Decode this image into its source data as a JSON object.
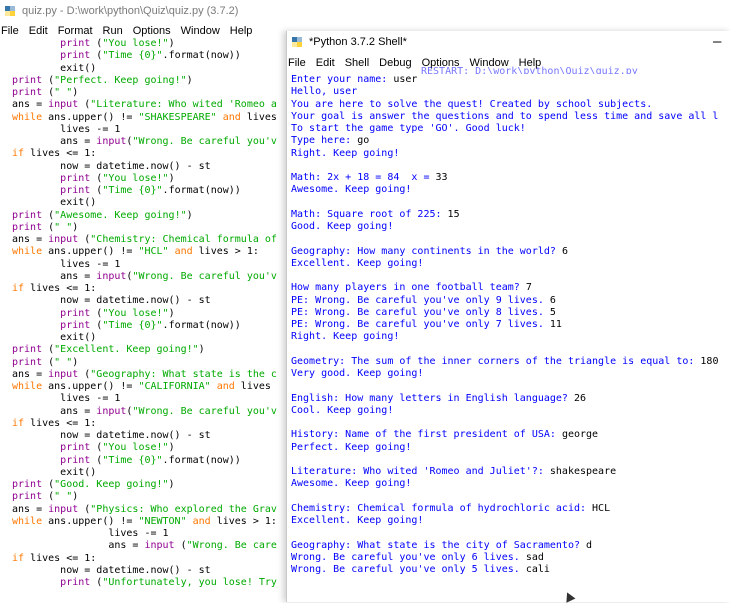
{
  "editor": {
    "title": "quiz.py - D:\\work\\python\\Quiz\\quiz.py (3.7.2)",
    "menu": [
      "File",
      "Edit",
      "Format",
      "Run",
      "Options",
      "Window",
      "Help"
    ],
    "lines": [
      {
        "indent": "        ",
        "parts": [
          [
            "bi",
            "print"
          ],
          [
            "tx",
            " ("
          ],
          [
            "st",
            "\"You lose!\""
          ],
          [
            "tx",
            ")"
          ]
        ]
      },
      {
        "indent": "        ",
        "parts": [
          [
            "bi",
            "print"
          ],
          [
            "tx",
            " ("
          ],
          [
            "st",
            "\"Time {0}\""
          ],
          [
            "tx",
            ".format(now))"
          ]
        ]
      },
      {
        "indent": "        ",
        "parts": [
          [
            "tx",
            "exit()"
          ]
        ]
      },
      {
        "indent": "",
        "parts": [
          [
            "bi",
            "print"
          ],
          [
            "tx",
            " ("
          ],
          [
            "st",
            "\"Perfect. Keep going!\""
          ],
          [
            "tx",
            ")"
          ]
        ]
      },
      {
        "indent": "",
        "parts": [
          [
            "bi",
            "print"
          ],
          [
            "tx",
            " ("
          ],
          [
            "st",
            "\" \""
          ],
          [
            "tx",
            ")"
          ]
        ]
      },
      {
        "indent": "",
        "parts": [
          [
            "tx",
            "ans = "
          ],
          [
            "bi",
            "input"
          ],
          [
            "tx",
            " ("
          ],
          [
            "st",
            "\"Literature: Who wited 'Romeo a"
          ]
        ]
      },
      {
        "indent": "",
        "parts": [
          [
            "kw",
            "while"
          ],
          [
            "tx",
            " ans.upper() != "
          ],
          [
            "st",
            "\"SHAKESPEARE\""
          ],
          [
            "tx",
            " "
          ],
          [
            "kw",
            "and"
          ],
          [
            "tx",
            " lives"
          ]
        ]
      },
      {
        "indent": "        ",
        "parts": [
          [
            "tx",
            "lives -= 1"
          ]
        ]
      },
      {
        "indent": "        ",
        "parts": [
          [
            "tx",
            "ans = "
          ],
          [
            "bi",
            "input"
          ],
          [
            "tx",
            "("
          ],
          [
            "st",
            "\"Wrong. Be careful you'v"
          ]
        ]
      },
      {
        "indent": "",
        "parts": [
          [
            "kw",
            "if"
          ],
          [
            "tx",
            " lives <= 1:"
          ]
        ]
      },
      {
        "indent": "        ",
        "parts": [
          [
            "tx",
            "now = datetime.now() - st"
          ]
        ]
      },
      {
        "indent": "        ",
        "parts": [
          [
            "bi",
            "print"
          ],
          [
            "tx",
            " ("
          ],
          [
            "st",
            "\"You lose!\""
          ],
          [
            "tx",
            ")"
          ]
        ]
      },
      {
        "indent": "        ",
        "parts": [
          [
            "bi",
            "print"
          ],
          [
            "tx",
            " ("
          ],
          [
            "st",
            "\"Time {0}\""
          ],
          [
            "tx",
            ".format(now))"
          ]
        ]
      },
      {
        "indent": "        ",
        "parts": [
          [
            "tx",
            "exit()"
          ]
        ]
      },
      {
        "indent": "",
        "parts": [
          [
            "bi",
            "print"
          ],
          [
            "tx",
            " ("
          ],
          [
            "st",
            "\"Awesome. Keep going!\""
          ],
          [
            "tx",
            ")"
          ]
        ]
      },
      {
        "indent": "",
        "parts": [
          [
            "bi",
            "print"
          ],
          [
            "tx",
            " ("
          ],
          [
            "st",
            "\" \""
          ],
          [
            "tx",
            ")"
          ]
        ]
      },
      {
        "indent": "",
        "parts": [
          [
            "tx",
            "ans = "
          ],
          [
            "bi",
            "input"
          ],
          [
            "tx",
            " ("
          ],
          [
            "st",
            "\"Chemistry: Chemical formula of"
          ]
        ]
      },
      {
        "indent": "",
        "parts": [
          [
            "kw",
            "while"
          ],
          [
            "tx",
            " ans.upper() != "
          ],
          [
            "st",
            "\"HCL\""
          ],
          [
            "tx",
            " "
          ],
          [
            "kw",
            "and"
          ],
          [
            "tx",
            " lives > 1:"
          ]
        ]
      },
      {
        "indent": "        ",
        "parts": [
          [
            "tx",
            "lives -= 1"
          ]
        ]
      },
      {
        "indent": "        ",
        "parts": [
          [
            "tx",
            "ans = "
          ],
          [
            "bi",
            "input"
          ],
          [
            "tx",
            "("
          ],
          [
            "st",
            "\"Wrong. Be careful you'v"
          ]
        ]
      },
      {
        "indent": "",
        "parts": [
          [
            "kw",
            "if"
          ],
          [
            "tx",
            " lives <= 1:"
          ]
        ]
      },
      {
        "indent": "        ",
        "parts": [
          [
            "tx",
            "now = datetime.now() - st"
          ]
        ]
      },
      {
        "indent": "        ",
        "parts": [
          [
            "bi",
            "print"
          ],
          [
            "tx",
            " ("
          ],
          [
            "st",
            "\"You lose!\""
          ],
          [
            "tx",
            ")"
          ]
        ]
      },
      {
        "indent": "        ",
        "parts": [
          [
            "bi",
            "print"
          ],
          [
            "tx",
            " ("
          ],
          [
            "st",
            "\"Time {0}\""
          ],
          [
            "tx",
            ".format(now))"
          ]
        ]
      },
      {
        "indent": "        ",
        "parts": [
          [
            "tx",
            "exit()"
          ]
        ]
      },
      {
        "indent": "",
        "parts": [
          [
            "bi",
            "print"
          ],
          [
            "tx",
            " ("
          ],
          [
            "st",
            "\"Excellent. Keep going!\""
          ],
          [
            "tx",
            ")"
          ]
        ]
      },
      {
        "indent": "",
        "parts": [
          [
            "bi",
            "print"
          ],
          [
            "tx",
            " ("
          ],
          [
            "st",
            "\" \""
          ],
          [
            "tx",
            ")"
          ]
        ]
      },
      {
        "indent": "",
        "parts": [
          [
            "tx",
            "ans = "
          ],
          [
            "bi",
            "input"
          ],
          [
            "tx",
            " ("
          ],
          [
            "st",
            "\"Geography: What state is the c"
          ]
        ]
      },
      {
        "indent": "",
        "parts": [
          [
            "kw",
            "while"
          ],
          [
            "tx",
            " ans.upper() != "
          ],
          [
            "st",
            "\"CALIFORNIA\""
          ],
          [
            "tx",
            " "
          ],
          [
            "kw",
            "and"
          ],
          [
            "tx",
            " lives"
          ]
        ]
      },
      {
        "indent": "        ",
        "parts": [
          [
            "tx",
            "lives -= 1"
          ]
        ]
      },
      {
        "indent": "        ",
        "parts": [
          [
            "tx",
            "ans = "
          ],
          [
            "bi",
            "input"
          ],
          [
            "tx",
            "("
          ],
          [
            "st",
            "\"Wrong. Be careful you'v"
          ]
        ]
      },
      {
        "indent": "",
        "parts": [
          [
            "kw",
            "if"
          ],
          [
            "tx",
            " lives <= 1:"
          ]
        ]
      },
      {
        "indent": "        ",
        "parts": [
          [
            "tx",
            "now = datetime.now() - st"
          ]
        ]
      },
      {
        "indent": "        ",
        "parts": [
          [
            "bi",
            "print"
          ],
          [
            "tx",
            " ("
          ],
          [
            "st",
            "\"You lose!\""
          ],
          [
            "tx",
            ")"
          ]
        ]
      },
      {
        "indent": "        ",
        "parts": [
          [
            "bi",
            "print"
          ],
          [
            "tx",
            " ("
          ],
          [
            "st",
            "\"Time {0}\""
          ],
          [
            "tx",
            ".format(now))"
          ]
        ]
      },
      {
        "indent": "        ",
        "parts": [
          [
            "tx",
            "exit()"
          ]
        ]
      },
      {
        "indent": "",
        "parts": [
          [
            "bi",
            "print"
          ],
          [
            "tx",
            " ("
          ],
          [
            "st",
            "\"Good. Keep going!\""
          ],
          [
            "tx",
            ")"
          ]
        ]
      },
      {
        "indent": "",
        "parts": [
          [
            "bi",
            "print"
          ],
          [
            "tx",
            " ("
          ],
          [
            "st",
            "\" \""
          ],
          [
            "tx",
            ")"
          ]
        ]
      },
      {
        "indent": "",
        "parts": [
          [
            "tx",
            "ans = "
          ],
          [
            "bi",
            "input"
          ],
          [
            "tx",
            " ("
          ],
          [
            "st",
            "\"Physics: Who explored the Grav"
          ]
        ]
      },
      {
        "indent": "",
        "parts": [
          [
            "kw",
            "while"
          ],
          [
            "tx",
            " ans.upper() != "
          ],
          [
            "st",
            "\"NEWTON\""
          ],
          [
            "tx",
            " "
          ],
          [
            "kw",
            "and"
          ],
          [
            "tx",
            " lives > 1:"
          ]
        ]
      },
      {
        "indent": "                ",
        "parts": [
          [
            "tx",
            "lives -= 1"
          ]
        ]
      },
      {
        "indent": "                ",
        "parts": [
          [
            "tx",
            "ans = "
          ],
          [
            "bi",
            "input"
          ],
          [
            "tx",
            " ("
          ],
          [
            "st",
            "\"Wrong. Be care"
          ]
        ]
      },
      {
        "indent": "",
        "parts": [
          [
            "kw",
            "if"
          ],
          [
            "tx",
            " lives <= 1:"
          ]
        ]
      },
      {
        "indent": "        ",
        "parts": [
          [
            "tx",
            "now = datetime.now() - st"
          ]
        ]
      },
      {
        "indent": "        ",
        "parts": [
          [
            "bi",
            "print"
          ],
          [
            "tx",
            " ("
          ],
          [
            "st",
            "\"Unfortunately, you lose! Try"
          ]
        ]
      }
    ]
  },
  "shell": {
    "title": "*Python 3.7.2 Shell*",
    "menu": [
      "File",
      "Edit",
      "Shell",
      "Debug",
      "Options",
      "Window",
      "Help"
    ],
    "partial_top": "RESTART: D:\\work\\python\\Quiz\\quiz.py",
    "minimize": "—",
    "lines": [
      [
        [
          "out",
          "Enter your name: "
        ],
        [
          "inp",
          "user"
        ]
      ],
      [
        [
          "out",
          "Hello, user"
        ]
      ],
      [
        [
          "out",
          "You are here to solve the quest! Created by school subjects."
        ]
      ],
      [
        [
          "out",
          "Your goal is answer the questions and to spend less time and save all l"
        ]
      ],
      [
        [
          "out",
          "To start the game type 'GO'. Good luck!"
        ]
      ],
      [
        [
          "out",
          "Type here: "
        ],
        [
          "inp",
          "go"
        ]
      ],
      [
        [
          "out",
          "Right. Keep going!"
        ]
      ],
      [
        [
          "out",
          ""
        ]
      ],
      [
        [
          "out",
          "Math: 2x + 18 = 84  x = "
        ],
        [
          "inp",
          "33"
        ]
      ],
      [
        [
          "out",
          "Awesome. Keep going!"
        ]
      ],
      [
        [
          "out",
          ""
        ]
      ],
      [
        [
          "out",
          "Math: Square root of 225: "
        ],
        [
          "inp",
          "15"
        ]
      ],
      [
        [
          "out",
          "Good. Keep going!"
        ]
      ],
      [
        [
          "out",
          ""
        ]
      ],
      [
        [
          "out",
          "Geography: How many continents in the world? "
        ],
        [
          "inp",
          "6"
        ]
      ],
      [
        [
          "out",
          "Excellent. Keep going!"
        ]
      ],
      [
        [
          "out",
          ""
        ]
      ],
      [
        [
          "out",
          "How many players in one football team? "
        ],
        [
          "inp",
          "7"
        ]
      ],
      [
        [
          "out",
          "PE: Wrong. Be careful you've only 9 lives. "
        ],
        [
          "inp",
          "6"
        ]
      ],
      [
        [
          "out",
          "PE: Wrong. Be careful you've only 8 lives. "
        ],
        [
          "inp",
          "5"
        ]
      ],
      [
        [
          "out",
          "PE: Wrong. Be careful you've only 7 lives. "
        ],
        [
          "inp",
          "11"
        ]
      ],
      [
        [
          "out",
          "Right. Keep going!"
        ]
      ],
      [
        [
          "out",
          ""
        ]
      ],
      [
        [
          "out",
          "Geometry: The sum of the inner corners of the triangle is equal to: "
        ],
        [
          "inp",
          "180"
        ]
      ],
      [
        [
          "out",
          "Very good. Keep going!"
        ]
      ],
      [
        [
          "out",
          ""
        ]
      ],
      [
        [
          "out",
          "English: How many letters in English language? "
        ],
        [
          "inp",
          "26"
        ]
      ],
      [
        [
          "out",
          "Cool. Keep going!"
        ]
      ],
      [
        [
          "out",
          ""
        ]
      ],
      [
        [
          "out",
          "History: Name of the first president of USA: "
        ],
        [
          "inp",
          "george"
        ]
      ],
      [
        [
          "out",
          "Perfect. Keep going!"
        ]
      ],
      [
        [
          "out",
          ""
        ]
      ],
      [
        [
          "out",
          "Literature: Who wited 'Romeo and Juliet'?: "
        ],
        [
          "inp",
          "shakespeare"
        ]
      ],
      [
        [
          "out",
          "Awesome. Keep going!"
        ]
      ],
      [
        [
          "out",
          ""
        ]
      ],
      [
        [
          "out",
          "Chemistry: Chemical formula of hydrochloric acid: "
        ],
        [
          "inp",
          "HCL"
        ]
      ],
      [
        [
          "out",
          "Excellent. Keep going!"
        ]
      ],
      [
        [
          "out",
          ""
        ]
      ],
      [
        [
          "out",
          "Geography: What state is the city of Sacramento? "
        ],
        [
          "inp",
          "d"
        ]
      ],
      [
        [
          "out",
          "Wrong. Be careful you've only 6 lives. "
        ],
        [
          "inp",
          "sad"
        ]
      ],
      [
        [
          "out",
          "Wrong. Be careful you've only 5 lives. "
        ],
        [
          "inp",
          "cali"
        ]
      ]
    ]
  },
  "colors": {
    "keyword": "#ff7700",
    "builtin": "#900090",
    "string": "#00aa00",
    "shell_output": "#0000ff"
  },
  "icons": {
    "editor_icon": "python-file-icon",
    "shell_icon": "python-shell-icon",
    "pointer": "mouse-cursor-icon"
  }
}
